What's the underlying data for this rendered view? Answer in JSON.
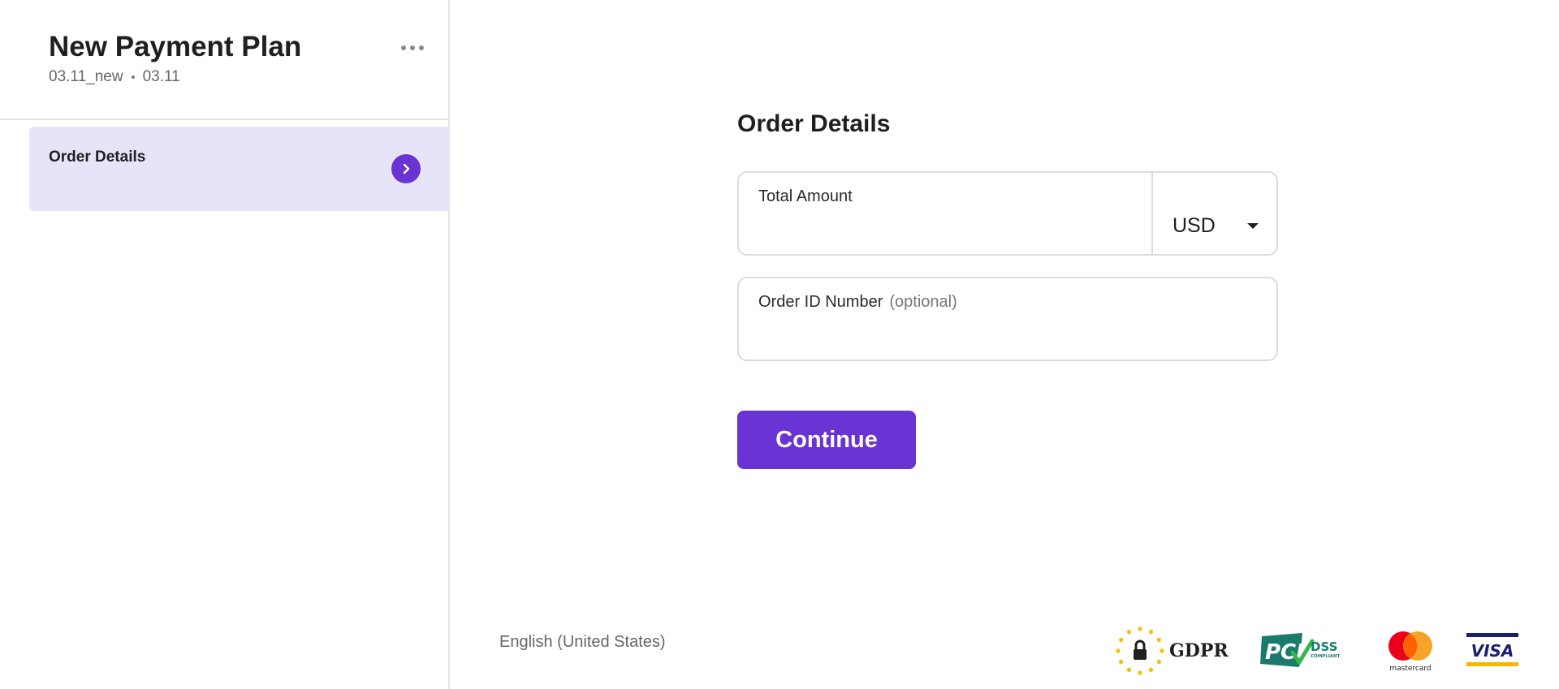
{
  "sidebar": {
    "title": "New Payment Plan",
    "subtitle_left": "03.11_new",
    "subtitle_right": "03.11",
    "steps": [
      {
        "label": "Order Details",
        "active": true
      }
    ]
  },
  "main": {
    "title": "Order Details",
    "fields": {
      "amount": {
        "label": "Total Amount",
        "value": ""
      },
      "order_id": {
        "label": "Order ID Number",
        "optional": "(optional)",
        "value": ""
      }
    },
    "currency": {
      "selected": "USD"
    },
    "continue_label": "Continue"
  },
  "footer": {
    "language": "English (United States)",
    "badges": {
      "gdpr": "GDPR",
      "pci": "PCI",
      "dss": "DSS",
      "compliant": "COMPLIANT",
      "mastercard": "mastercard",
      "visa": "VISA"
    }
  },
  "colors": {
    "accent": "#6a33d4",
    "active_step_bg": "#e7e4f9",
    "border": "#dcdcdc"
  }
}
